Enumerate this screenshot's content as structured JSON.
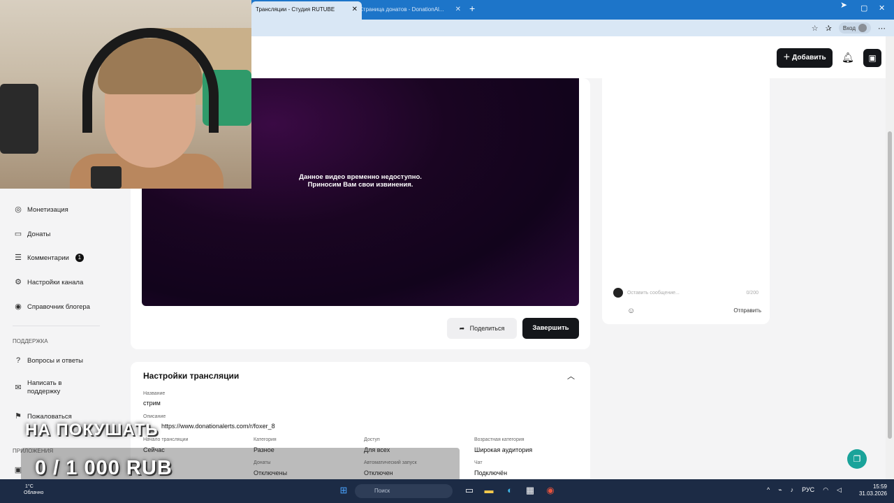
{
  "browser": {
    "tab_active": "Трансляции - Студия RUTUBE",
    "tab_second": "Страница донатов - DonationAl...",
    "close_glyph": "✕",
    "plus_glyph": "+",
    "login_label": "Вход"
  },
  "header": {
    "add_label": "Добавить"
  },
  "sidebar": {
    "items": [
      {
        "label": "Монетизация"
      },
      {
        "label": "Донаты"
      },
      {
        "label": "Комментарии",
        "badge": "1"
      },
      {
        "label": "Настройки канала"
      },
      {
        "label": "Справочник блогера"
      }
    ],
    "support_section": "ПОДДЕРЖКА",
    "support_items": [
      {
        "label": "Вопросы и ответы"
      },
      {
        "label": "Написать в поддержку"
      },
      {
        "label": "Пожаловаться"
      }
    ],
    "apps_section": "ПРИЛОЖЕНИЯ"
  },
  "video": {
    "message_line1": "Данное видео временно недоступно.",
    "message_line2": "Приносим Вам свои извинения."
  },
  "actions": {
    "share_label": "Поделиться",
    "end_label": "Завершить"
  },
  "chat": {
    "placeholder": "Оставить сообщение...",
    "counter": "0/200",
    "send_label": "Отправить"
  },
  "settings": {
    "title": "Настройки трансляции",
    "name_label": "Название",
    "name_value": "стрим",
    "desc_label": "Описание",
    "desc_value": "https://www.donationalerts.com/r/foxer_8",
    "start_label": "Начало трансляции",
    "start_value": "Сейчас",
    "category_label": "Категория",
    "category_value": "Разное",
    "access_label": "Доступ",
    "access_value": "Для всех",
    "age_label": "Возрастная категория",
    "age_value": "Широкая аудитория",
    "donations_label": "Донаты",
    "donations_value": "Отключены",
    "autostart_label": "Автоматический запуск",
    "autostart_value": "Отключен",
    "chat_label": "Чат",
    "chat_value": "Подключён"
  },
  "overlay": {
    "title": "НА ПОКУШАТЬ",
    "amount": "0 / 1 000 RUB"
  },
  "taskbar": {
    "weather_temp": "1°C",
    "weather_desc": "Облачно",
    "search_placeholder": "Поиск",
    "lang": "РУС",
    "time": "15:59",
    "date": "31.03.2026"
  }
}
